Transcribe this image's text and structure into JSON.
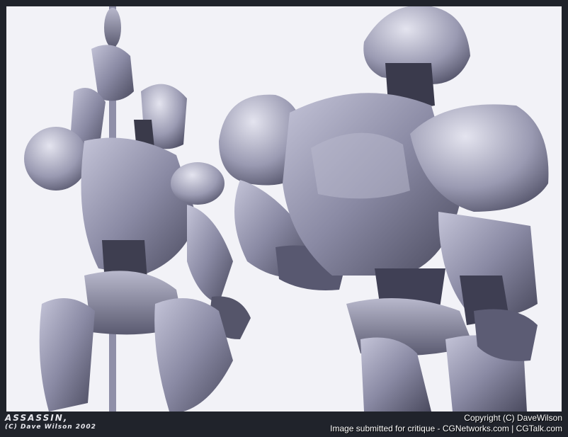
{
  "artwork": {
    "title": "ASSASSIN,",
    "byline": "(C) Dave Wilson 2002",
    "copyright": "Copyright (C) DaveWilson",
    "submission_note": "Image submitted for critique - CGNetworks.com | CGTalk.com"
  },
  "colors": {
    "background": "#f2f2f7",
    "frame": "#20232b",
    "robot_light": "#a8a8c0",
    "robot_mid": "#6e6e88",
    "robot_dark": "#2e2e3c"
  }
}
